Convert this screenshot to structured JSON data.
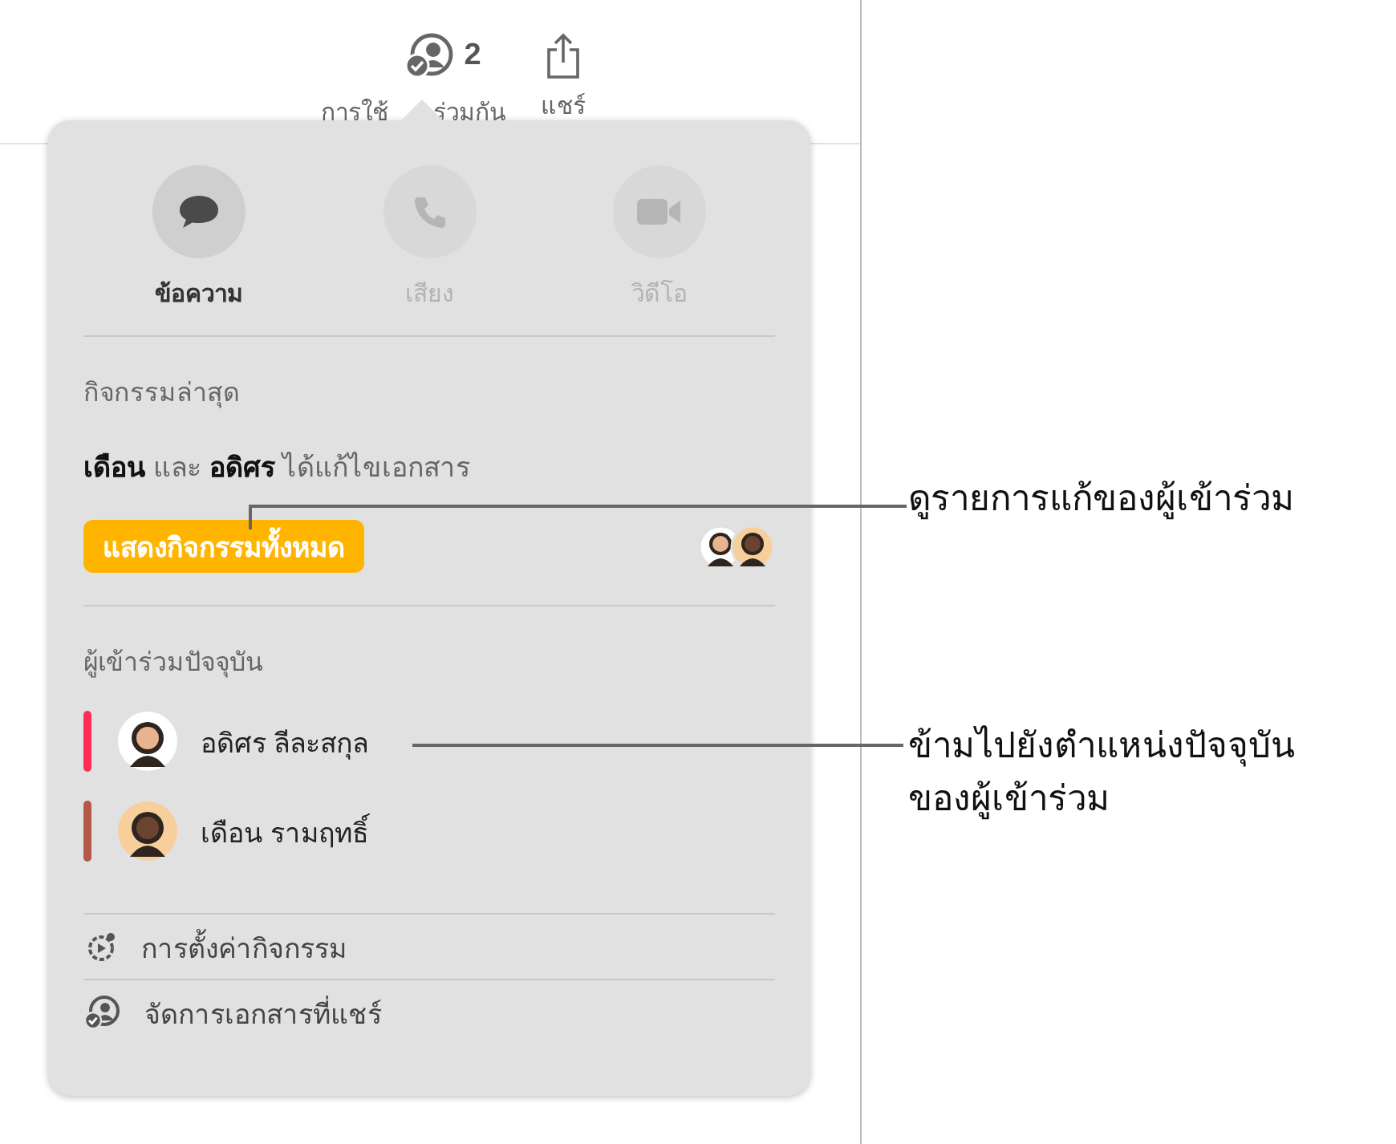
{
  "toolbar": {
    "collaborate": {
      "count": "2",
      "label_parts": [
        "การใช้",
        "ร่วมกัน"
      ]
    },
    "share": {
      "label": "แชร์"
    }
  },
  "popover": {
    "actions": [
      {
        "kind": "message",
        "label": "ข้อความ",
        "disabled": false
      },
      {
        "kind": "audio",
        "label": "เสียง",
        "disabled": true
      },
      {
        "kind": "video",
        "label": "วิดีโอ",
        "disabled": true
      }
    ],
    "recent_activity": {
      "heading": "กิจกรรมล่าสุด",
      "summary": "**เดือน** และ **อดิศร** ได้แก้ไขเอกสาร",
      "button": "แสดงกิจกรรมทั้งหมด"
    },
    "participants": {
      "heading": "ผู้เข้าร่วมปัจจุบัน",
      "items": [
        {
          "name": "อดิศร ลีละสกุล",
          "color": "#ff2d55"
        },
        {
          "name": "เดือน รามฤทธิ์",
          "color": "#b4584a"
        }
      ]
    },
    "menu": [
      {
        "kind": "settings",
        "label": "การตั้งค่ากิจกรรม"
      },
      {
        "kind": "manage",
        "label": "จัดการเอกสารที่แชร์"
      }
    ]
  },
  "callouts": [
    {
      "lines": [
        "ดูรายการแก้ของผู้เข้าร่วม"
      ]
    },
    {
      "lines": [
        "ข้ามไปยังตำแหน่งปัจจุบัน",
        "ของผู้เข้าร่วม"
      ]
    }
  ]
}
